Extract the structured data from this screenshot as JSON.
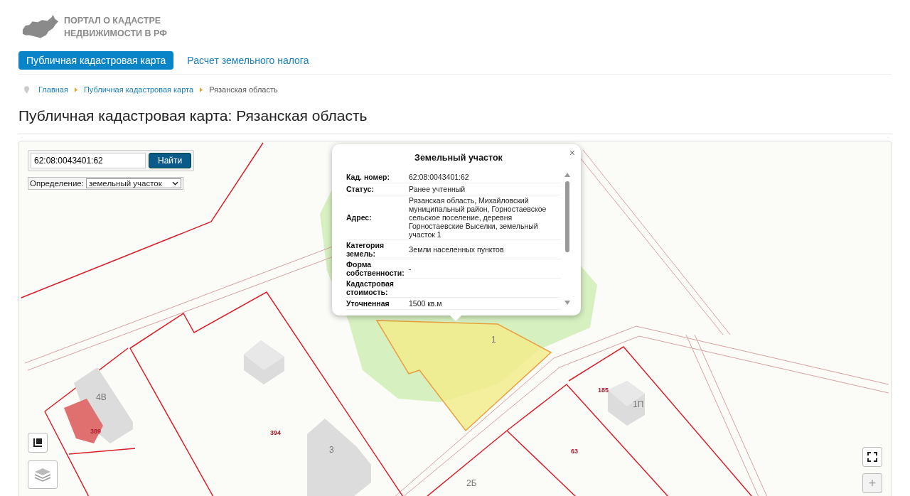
{
  "header": {
    "logo_line_1": "ПОРТАЛ О КАДАСТРЕ",
    "logo_line_2": "НЕДВИЖИМОСТИ В РФ"
  },
  "nav": [
    {
      "label": "Публичная кадастровая карта",
      "selected": true
    },
    {
      "label": "Расчет земельного налога",
      "selected": false
    }
  ],
  "breadcrumbs": [
    {
      "label": "Главная",
      "link": true
    },
    {
      "label": "Публичная кадастровая карта",
      "link": true
    },
    {
      "label": "Рязанская область",
      "link": false
    }
  ],
  "title": "Публичная кадастровая карта: Рязанская область",
  "map": {
    "search": {
      "value": "62:08:0043401:62",
      "button": "Найти"
    },
    "definition": {
      "label": "Определение:",
      "value": "земельный участок"
    },
    "labels": [
      {
        "text": "4В",
        "kind": "building"
      },
      {
        "text": "389",
        "kind": "parcel"
      },
      {
        "text": "394",
        "kind": "parcel"
      },
      {
        "text": "3",
        "kind": "building"
      },
      {
        "text": "1",
        "kind": "building"
      },
      {
        "text": "185",
        "kind": "parcel"
      },
      {
        "text": "1П",
        "kind": "building"
      },
      {
        "text": "63",
        "kind": "parcel"
      },
      {
        "text": "2Б",
        "kind": "building"
      }
    ],
    "zoom_in": "+",
    "popup": {
      "title": "Земельный участок",
      "close": "×",
      "rows": [
        {
          "label": "Кад. номер:",
          "value": "62:08:0043401:62"
        },
        {
          "label": "Статус:",
          "value": "Ранее учтенный"
        },
        {
          "label": "Адрес:",
          "value": "Рязанская область, Михайловский муниципальный район, Горностаевское сельское поселение, деревня Горностаевские Выселки, земельный участок 1"
        },
        {
          "label": "Категория земель:",
          "value": "Земли населенных пунктов"
        },
        {
          "label": "Форма собственности:",
          "value": "-"
        },
        {
          "label": "Кадастровая стоимость:"
        },
        {
          "label": "Уточненная",
          "value": "1500 кв.м"
        }
      ]
    }
  }
}
